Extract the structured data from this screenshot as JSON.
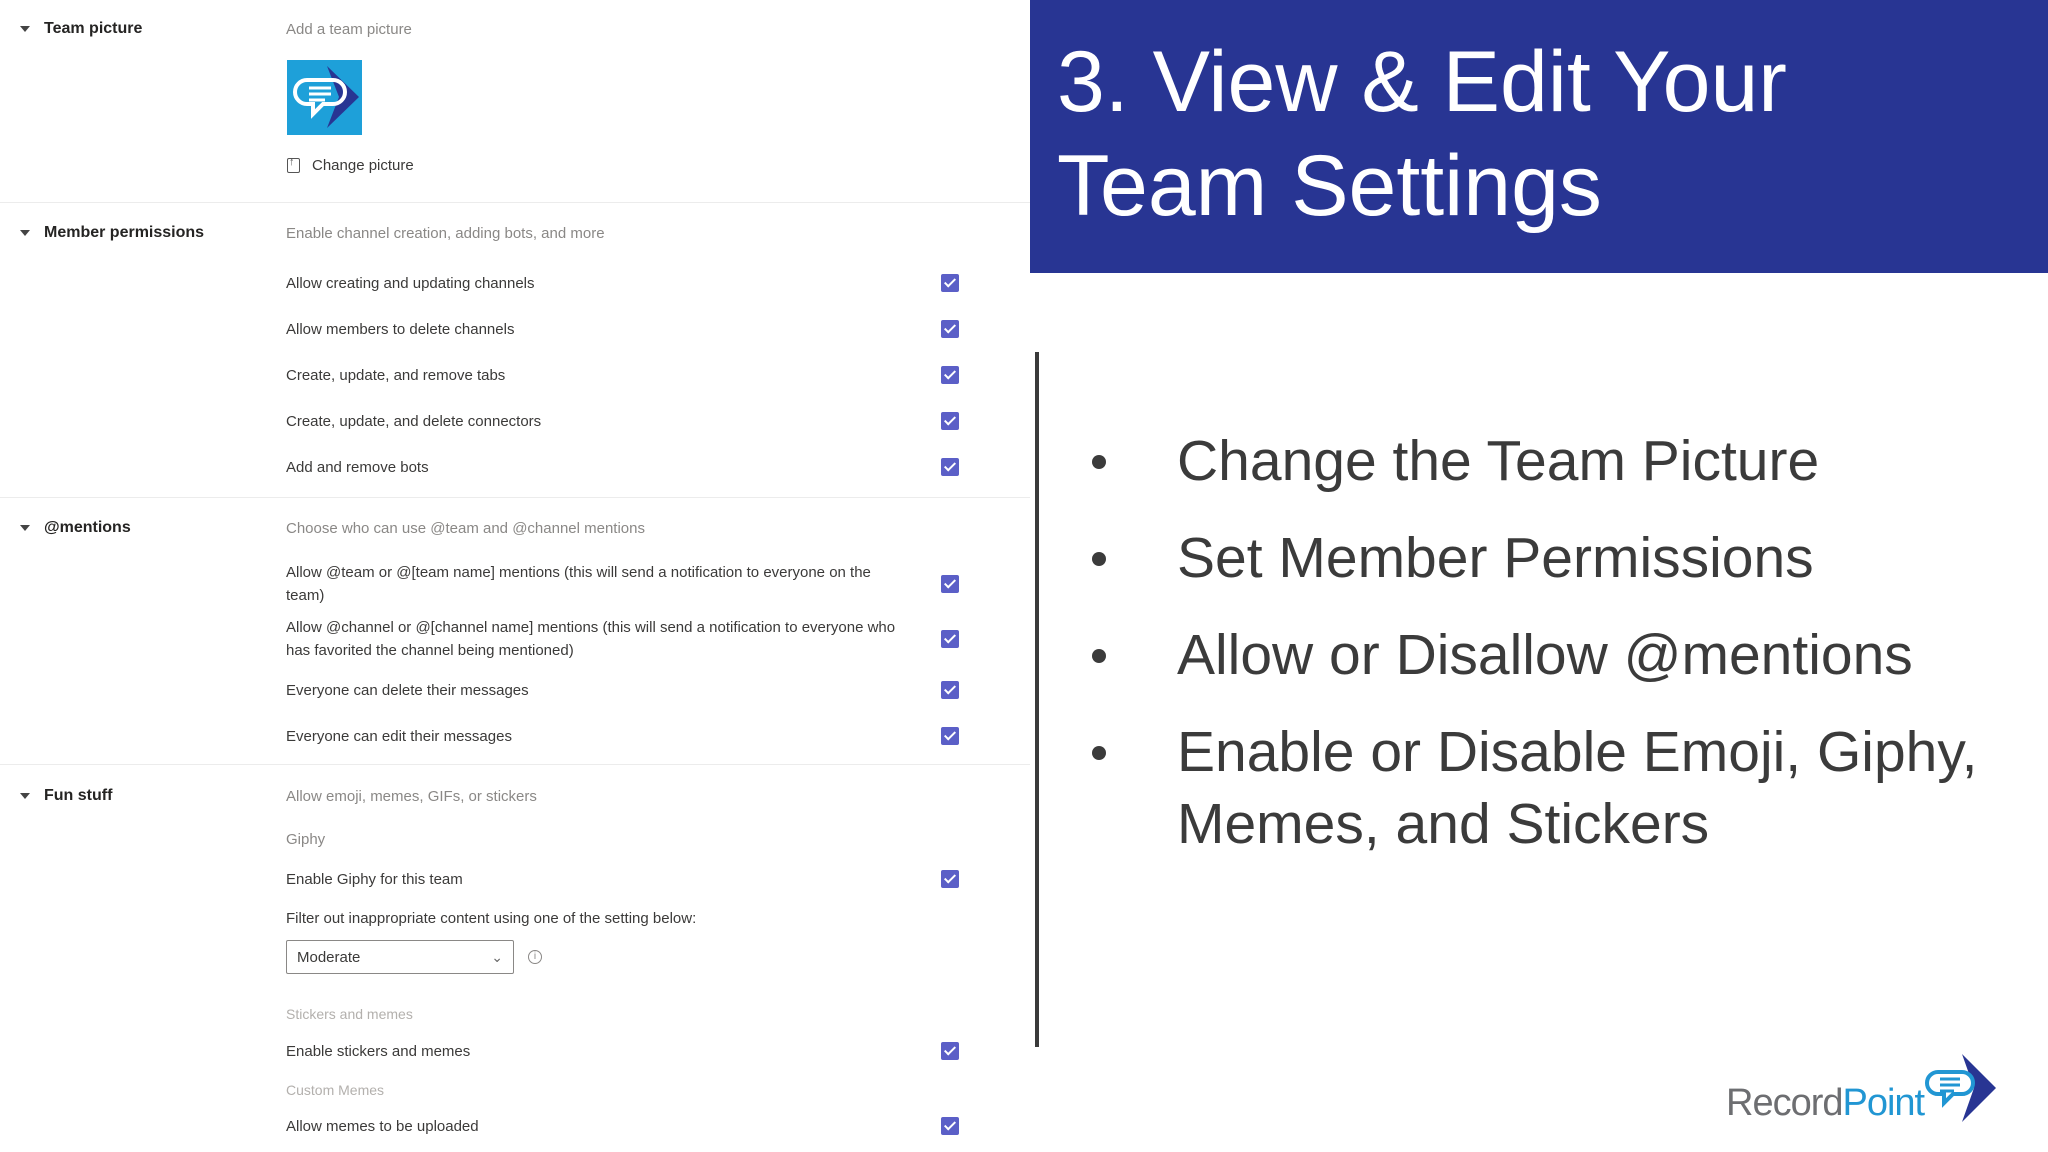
{
  "settings": {
    "team_picture": {
      "heading": "Team picture",
      "description": "Add a team picture",
      "change_label": "Change picture"
    },
    "member_permissions": {
      "heading": "Member permissions",
      "description": "Enable channel creation, adding bots, and more",
      "items": [
        {
          "label": "Allow creating and updating channels",
          "checked": true
        },
        {
          "label": "Allow members to delete channels",
          "checked": true
        },
        {
          "label": "Create, update, and remove tabs",
          "checked": true
        },
        {
          "label": "Create, update, and delete connectors",
          "checked": true
        },
        {
          "label": "Add and remove bots",
          "checked": true
        }
      ]
    },
    "mentions": {
      "heading": "@mentions",
      "description": "Choose who can use @team and @channel mentions",
      "items": [
        {
          "label": "Allow @team or @[team name] mentions (this will send a notification to everyone on the team)",
          "checked": true
        },
        {
          "label": "Allow @channel or @[channel name] mentions (this will send a notification to everyone who has favorited the channel being mentioned)",
          "checked": true
        },
        {
          "label": "Everyone can delete their messages",
          "checked": true
        },
        {
          "label": "Everyone can edit their messages",
          "checked": true
        }
      ]
    },
    "fun_stuff": {
      "heading": "Fun stuff",
      "description": "Allow emoji, memes, GIFs, or stickers",
      "giphy_heading": "Giphy",
      "giphy_enable": {
        "label": "Enable Giphy for this team",
        "checked": true
      },
      "filter_label": "Filter out inappropriate content using one of the setting below:",
      "filter_value": "Moderate",
      "stickers_heading": "Stickers and memes",
      "stickers_enable": {
        "label": "Enable stickers and memes",
        "checked": true
      },
      "custom_heading": "Custom Memes",
      "custom_enable": {
        "label": "Allow memes to be uploaded",
        "checked": true
      }
    }
  },
  "slide": {
    "title": "3. View & Edit Your Team Settings",
    "bullets": [
      "Change the Team Picture",
      "Set Member Permissions",
      "Allow or Disallow @mentions",
      "Enable or Disable Emoji, Giphy, Memes, and Stickers"
    ],
    "logo_part1": "Record",
    "logo_part2": "Point"
  },
  "colors": {
    "title_bg": "#283593",
    "checkbox": "#5b5fc7",
    "logo_blue": "#2196d3"
  },
  "icons": {
    "team_picture": "recordpoint-logo-icon",
    "change_picture": "upload-icon",
    "dropdown": "chevron-down-icon",
    "info": "info-icon",
    "section_toggle": "caret-down-icon"
  }
}
